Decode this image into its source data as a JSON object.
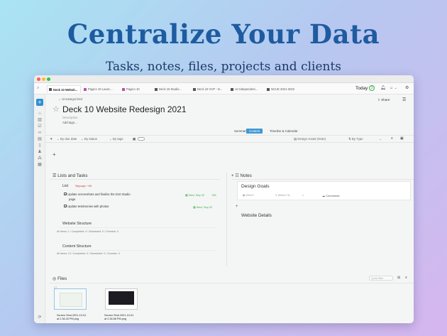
{
  "hero": {
    "title": "Centralize Your Data",
    "subtitle": "Tasks, notes, files, projects and clients"
  },
  "tabs": [
    {
      "label": "Deck 10 Websit...",
      "active": true
    },
    {
      "label": "Pagico 10 Launc..."
    },
    {
      "label": "Pagico 10"
    },
    {
      "label": "Deck 10 Studio..."
    },
    {
      "label": "Deck 10 VCP - N..."
    },
    {
      "label": "UI Independent..."
    },
    {
      "label": "NCUE 2021-2022"
    }
  ],
  "topbar": {
    "today_label": "Today",
    "today_count": "3"
  },
  "header": {
    "category": "Uncategorized",
    "share_label": "Share",
    "title": "Deck 10 Website Redesign 2021",
    "description": "Description",
    "add_tags": "Add tags..."
  },
  "view_tabs": [
    "Summary",
    "Content",
    "Timeline & Calendar"
  ],
  "filters": {
    "due_date": "By due date",
    "status": "By status",
    "tags": "By tags",
    "sort_left": "Design Goals (Note)",
    "sort_right": "By Type"
  },
  "lists_section": {
    "title": "Lists and Tasks",
    "list_name": "List",
    "list_meta": "Slippage: +66",
    "tasks": [
      {
        "text": "Update screenshots and finalize the D10 Studio",
        "text2": "page",
        "date": "Wed, Sep 22",
        "delta": "+63"
      },
      {
        "text": "Update testimonies with photos",
        "date": "Wed, Sep 22"
      }
    ],
    "subsections": [
      {
        "title": "Website Structure",
        "stats": "All Items: 1 / Completed: 0 / Scheduled: 0 / Overdue: 0"
      },
      {
        "title": "Content Structure",
        "stats": "All Items: 13 / Completed: 0 / Scheduled: 0 / Overdue: 0"
      }
    ]
  },
  "notes_section": {
    "title": "Notes",
    "note_title": "Design Goals",
    "note_when": "When?",
    "note_where": "Where?",
    "note_comments": "Comments",
    "details_title": "Website Details"
  },
  "files_section": {
    "title": "Files",
    "search_placeholder": "Quick filter",
    "files": [
      {
        "name": "Screen Shot 2021-10-01",
        "name2": "at 2.36.33 PM.png"
      },
      {
        "name": "Screen Shot 2021-10-01",
        "name2": "at 2.36.58 PM.png"
      }
    ]
  }
}
